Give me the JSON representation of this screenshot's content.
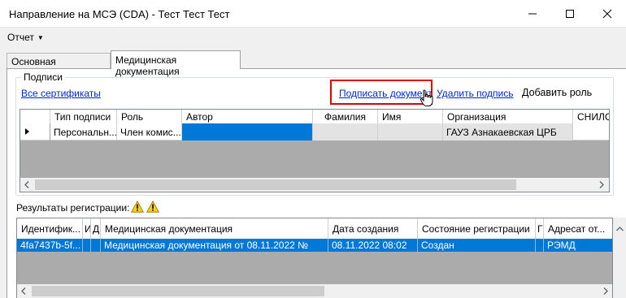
{
  "window": {
    "title": "Направление на МСЭ (CDA) - Тест Тест Тест"
  },
  "menu": {
    "report_label": "Отчет"
  },
  "tabs": [
    {
      "label": "Основная информация",
      "active": false
    },
    {
      "label": "Медицинская документация",
      "active": true
    }
  ],
  "signatures": {
    "group_label": "Подписи",
    "all_certs_link": "Все сертификаты",
    "sign_link": "Подписать документ",
    "delete_link": "Удалить подпись",
    "add_role_button": "Добавить роль",
    "columns": [
      "Тип подписи",
      "Роль",
      "Автор",
      "Фамилия",
      "Имя",
      "Организация",
      "СНИЛС"
    ],
    "rows": [
      {
        "type": "Персональн...",
        "role": "Член комис...",
        "author": "",
        "lastname": "",
        "firstname": "",
        "organization": "ГАУЗ Азнакаевская ЦРБ",
        "snils": ""
      }
    ]
  },
  "registration": {
    "label": "Результаты регистрации:",
    "columns": [
      "Идентифик...",
      "И",
      "Д",
      "Медицинская документация",
      "Дата создания",
      "Состояние регистрации",
      "Г",
      "Адресат от..."
    ],
    "rows": [
      {
        "id": "4fa7437b-5f...",
        "c1": "",
        "c2": "",
        "doc": "Медицинская документация от 08.11.2022 №",
        "created": "08.11.2022 08:02",
        "state": "Создан",
        "c6": "",
        "addressee": "РЭМД"
      }
    ]
  },
  "colors": {
    "selection": "#0078d7",
    "link": "#0026d6",
    "highlight_box": "#e00000",
    "warning": "#f5d40f"
  }
}
